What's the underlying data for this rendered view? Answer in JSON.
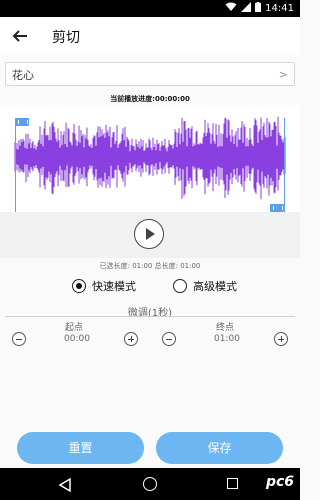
{
  "status_bar": {
    "time": "14:41"
  },
  "header": {
    "title": "剪切"
  },
  "file": {
    "name": "花心"
  },
  "player": {
    "progress_label": "当前播放进度:00:00:00"
  },
  "info": {
    "length_text": "已选长度: 01:00 总长度: 01:00"
  },
  "modes": {
    "fast_label": "快速模式",
    "advanced_label": "高级模式",
    "selected": "fast"
  },
  "fine_tune": {
    "title": "微调(1秒)",
    "start_label": "起点",
    "start_time": "00:00",
    "end_label": "终点",
    "end_time": "01:00"
  },
  "actions": {
    "reset_label": "重置",
    "save_label": "保存"
  },
  "nav": {
    "watermark": "pc6"
  },
  "colors": {
    "waveform": "#8a3fe0",
    "accent": "#6cb6f2",
    "handle": "#5a9fe8"
  }
}
